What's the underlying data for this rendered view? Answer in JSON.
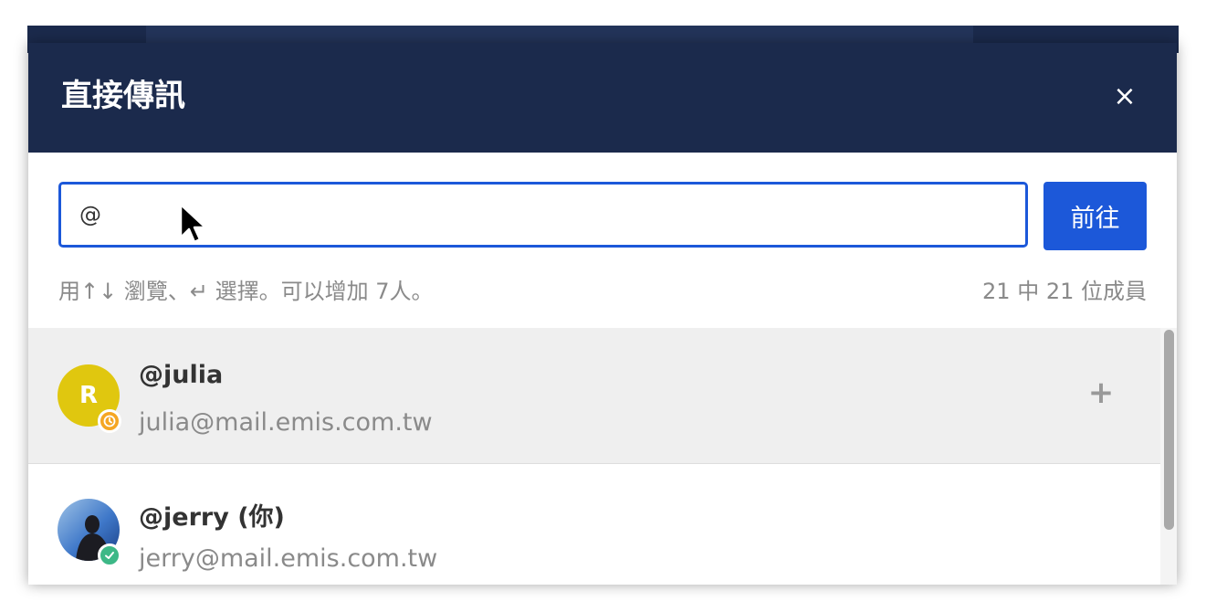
{
  "backdrop": {
    "search_icon": "search-icon"
  },
  "modal": {
    "title": "直接傳訊",
    "close_label": "×",
    "search": {
      "value": "@",
      "placeholder": ""
    },
    "go_button_label": "前往",
    "help_text": "用↑↓ 瀏覽、↵ 選擇。可以增加 7人。",
    "member_count": "21 中 21 位成員",
    "users": [
      {
        "avatar_letter": "R",
        "avatar_color": "#e0c70f",
        "status": "away",
        "username": "@julia",
        "email": "julia@mail.emis.com.tw",
        "action": "+",
        "selected": true
      },
      {
        "avatar_letter": "",
        "status": "online",
        "username": "@jerry (你)",
        "email": "jerry@mail.emis.com.tw",
        "selected": false
      }
    ]
  },
  "colors": {
    "header": "#1b2a4c",
    "accent": "#1c58d9",
    "away": "#f5a623",
    "online": "#3db887"
  }
}
